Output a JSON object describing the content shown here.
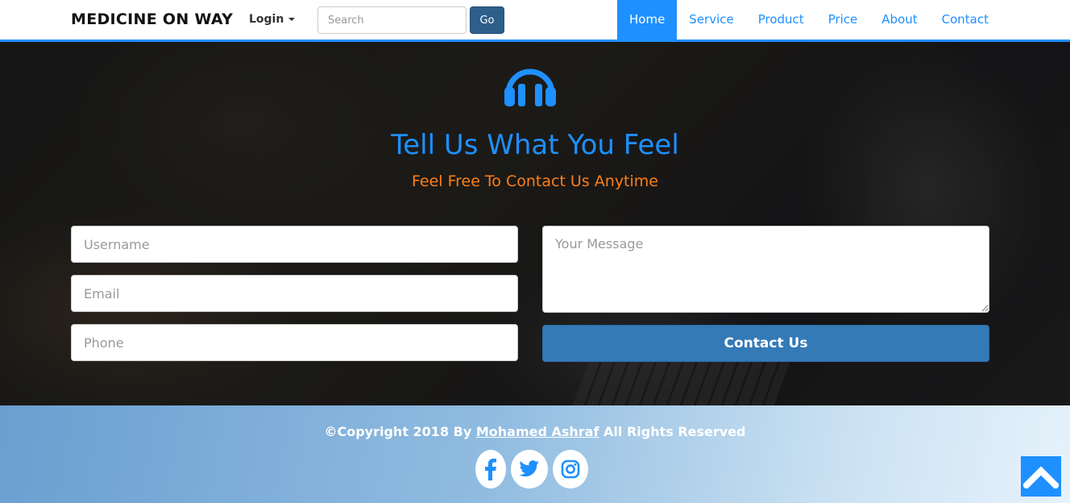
{
  "navbar": {
    "brand": "MEDICINE ON WAY",
    "login_label": "Login",
    "search_placeholder": "Search",
    "go_label": "Go",
    "links": [
      {
        "label": "Home",
        "active": true
      },
      {
        "label": "Service"
      },
      {
        "label": "Product"
      },
      {
        "label": "Price"
      },
      {
        "label": "About"
      },
      {
        "label": "Contact"
      }
    ]
  },
  "hero": {
    "icon": "headset-icon",
    "title": "Tell Us What You Feel",
    "subtitle": "Feel Free To Contact Us Anytime",
    "form": {
      "username_placeholder": "Username",
      "email_placeholder": "Email",
      "phone_placeholder": "Phone",
      "message_placeholder": "Your Message",
      "submit_label": "Contact Us"
    }
  },
  "footer": {
    "copyright_prefix": "©Copyright 2018 By",
    "author": "Mohamed Ashraf",
    "copyright_suffix": "All Rights Reserved",
    "socials": [
      "facebook-icon",
      "twitter-icon",
      "instagram-icon"
    ]
  },
  "colors": {
    "accent": "#1e90ff",
    "subtitle": "#ff7f16",
    "button": "#337ab7"
  }
}
